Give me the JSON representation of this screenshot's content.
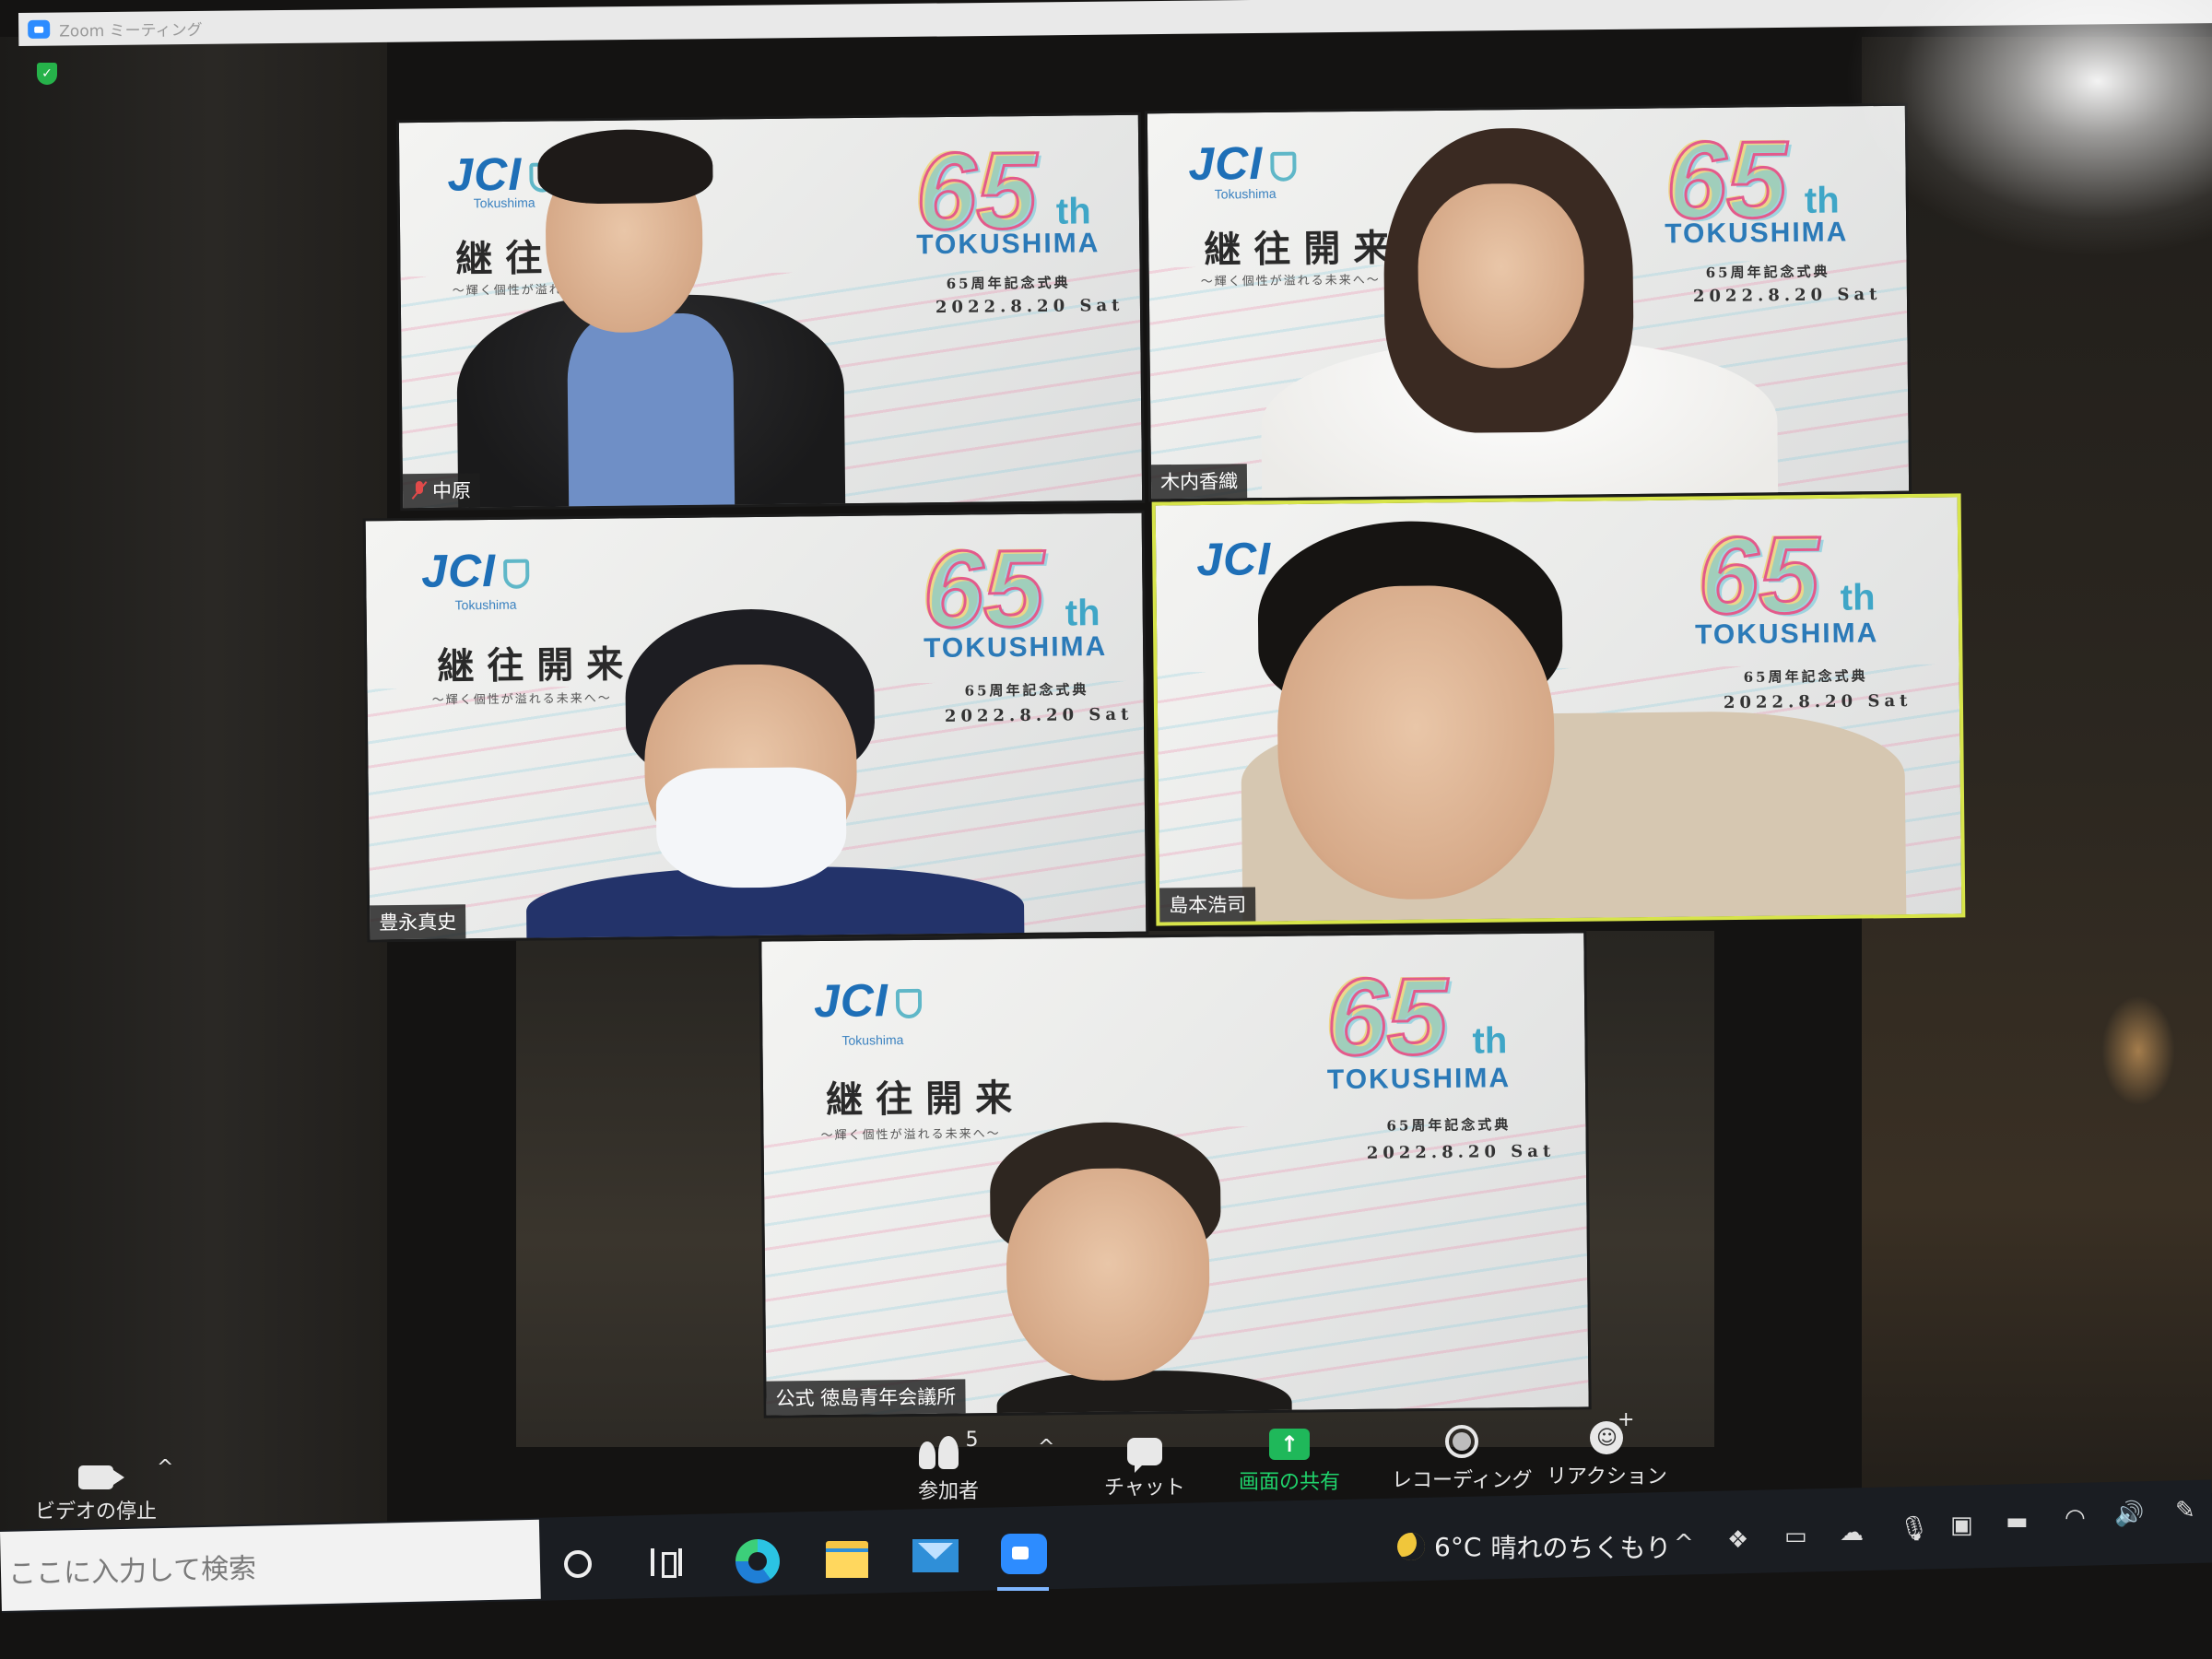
{
  "window": {
    "title": "Zoom ミーティング"
  },
  "slide": {
    "org": "JCI",
    "org_sub": "Tokushima",
    "slogan": "継往開来",
    "slogan_sub": "〜輝く個性が溢れる未来へ〜",
    "anniv_number": "65",
    "anniv_suffix": "th",
    "city": "TOKUSHIMA",
    "ceremony": "65周年記念式典",
    "date": "2022.8.20 Sat"
  },
  "participants": [
    {
      "name": "中原",
      "muted": true,
      "speaking": false
    },
    {
      "name": "木内香織",
      "muted": false,
      "speaking": false
    },
    {
      "name": "豊永真史",
      "muted": false,
      "speaking": false
    },
    {
      "name": "島本浩司",
      "muted": false,
      "speaking": true
    },
    {
      "name": "公式 徳島青年会議所",
      "muted": false,
      "speaking": false
    }
  ],
  "toolbar": {
    "video_label": "ビデオの停止",
    "participants_label": "参加者",
    "participants_count": "5",
    "chat_label": "チャット",
    "share_label": "画面の共有",
    "record_label": "レコーディング",
    "reaction_label": "リアクション",
    "caret": "^",
    "share_glyph": "↑"
  },
  "taskbar": {
    "search_placeholder": "ここに入力して検索",
    "weather_temp": "6°C",
    "weather_text": "晴れのちくもり",
    "tray_caret": "^"
  },
  "colors": {
    "zoom_blue": "#2d8cff",
    "share_green": "#1fb85a",
    "speaker_border": "#d7e44a"
  }
}
